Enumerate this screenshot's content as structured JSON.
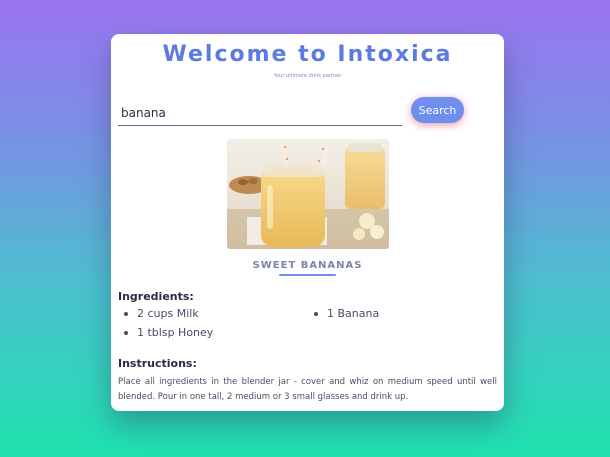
{
  "header": {
    "title": "Welcome to Intoxica",
    "subtitle": "Your ultimate drink partner"
  },
  "search": {
    "value": "banana",
    "button_label": "Search"
  },
  "drink": {
    "name": "SWEET BANANAS",
    "image_icon": "banana-smoothie-photo"
  },
  "ingredients": {
    "heading": "Ingredients:",
    "items": [
      "2 cups Milk",
      "1 Banana",
      "1 tblsp Honey"
    ]
  },
  "instructions": {
    "heading": "Instructions:",
    "text": "Place all ingredients in the blender jar - cover and whiz on medium speed until well blended. Pour in one tall, 2 medium or 3 small glasses and drink up."
  },
  "colors": {
    "accent": "#5b7be0",
    "button": "#6e8ff0",
    "gradient_top": "#9b74f0",
    "gradient_bottom": "#1ee3ae"
  }
}
